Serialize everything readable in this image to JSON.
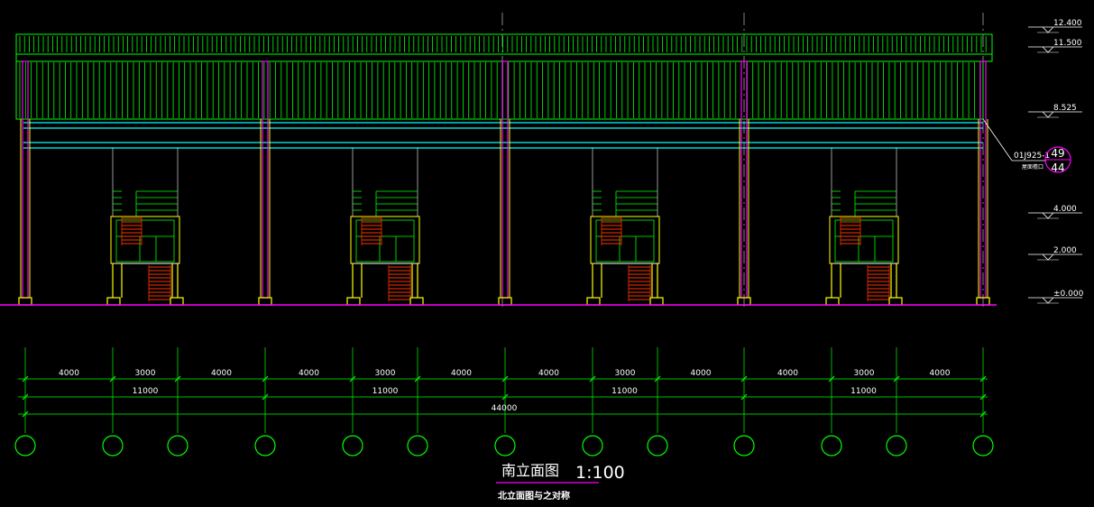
{
  "drawing": {
    "title": "南立面图",
    "scale": "1:100",
    "note": "北立面图与之对称"
  },
  "levels": [
    "12.400",
    "11.500",
    "8.525",
    "4.000",
    "2.000",
    "±0.000"
  ],
  "detail_callout": {
    "reference": "01J925-1",
    "sub_label": "屋面檐口",
    "numerator": "49",
    "denominator": "44"
  },
  "dimensions": {
    "bay_spans": [
      "4000",
      "3000",
      "4000",
      "4000",
      "3000",
      "4000",
      "4000",
      "3000",
      "4000",
      "4000",
      "3000",
      "4000"
    ],
    "module_spans": [
      "11000",
      "11000",
      "11000",
      "11000"
    ],
    "total_span": "44000"
  },
  "colors": {
    "background": "#000000",
    "roof_panel": "#00ff00",
    "beam": "#00ffff",
    "column": "#ff00ff",
    "footing": "#ffff00",
    "stair": "#ff3300",
    "text": "#ffffff",
    "dimension": "#00ff00",
    "ground": "#ff00ff"
  }
}
